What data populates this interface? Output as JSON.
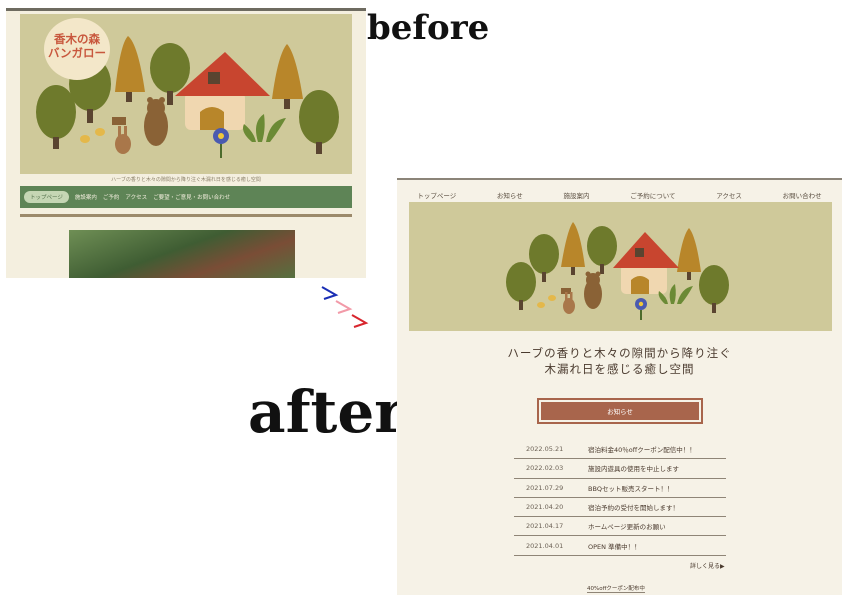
{
  "labels": {
    "before": "before",
    "after": "after"
  },
  "before_page": {
    "logo_line1": "香木の森",
    "logo_line2": "バンガロー",
    "tagline": "ハーブの香りと木々の隙間から降り注ぐ木漏れ日を感じる癒し空間",
    "nav": [
      "トップページ",
      "施設案内",
      "ご予約",
      "アクセス",
      "ご要望・ご意見・お問い合わせ"
    ]
  },
  "after_page": {
    "nav": [
      "トップページ",
      "お知らせ",
      "施設案内",
      "ご予約について",
      "アクセス",
      "お問い合わせ"
    ],
    "catch_line1": "ハーブの香りと木々の隙間から降り注ぐ",
    "catch_line2": "木漏れ日を感じる癒し空間",
    "news_button": "お知らせ",
    "news": [
      {
        "date": "2022.05.21",
        "title": "宿泊料金40％offクーポン配信中！！"
      },
      {
        "date": "2022.02.03",
        "title": "施設内遊具の使用を中止します"
      },
      {
        "date": "2021.07.29",
        "title": "BBQセット販売スタート！！"
      },
      {
        "date": "2021.04.20",
        "title": "宿泊予約の受付を開始します！"
      },
      {
        "date": "2021.04.17",
        "title": "ホームページ更新のお願い"
      },
      {
        "date": "2021.04.01",
        "title": "OPEN 準備中！！"
      }
    ],
    "more_link": "詳しく見る▶",
    "coupon_heading": "40%offクーポン配布中"
  },
  "colors": {
    "hero_bg": "#cfc99a",
    "nav_green": "#5e8456",
    "accent_brown": "#a8654c",
    "roof_red": "#c8452f",
    "tree_olive": "#6e7a2c",
    "cone_orange": "#b8862a"
  }
}
